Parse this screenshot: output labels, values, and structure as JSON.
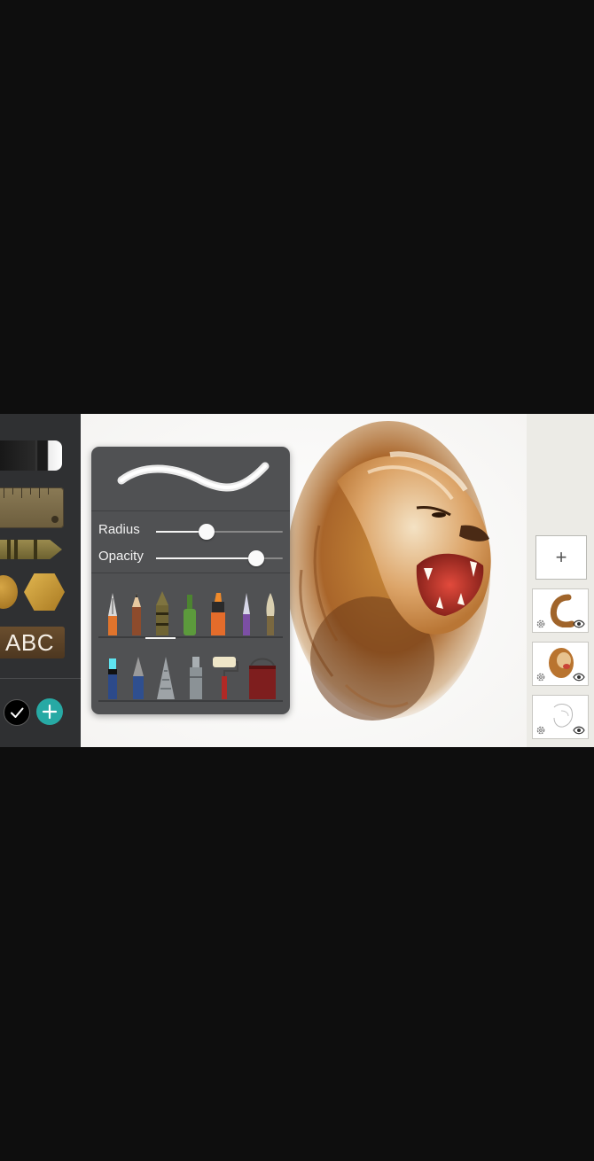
{
  "tools": {
    "items": [
      {
        "name": "paint tube"
      },
      {
        "name": "ruler"
      },
      {
        "name": "crayon"
      },
      {
        "name": "circle shape"
      },
      {
        "name": "hexagon shape"
      }
    ],
    "text_tool_label": "ABC"
  },
  "color": {
    "current": "#000000",
    "add_icon": "plus-icon",
    "accent": "#27A9A4"
  },
  "brush_panel": {
    "radius_label": "Radius",
    "radius_value": 0.4,
    "opacity_label": "Opacity",
    "opacity_value": 0.79,
    "row1": [
      "fountain pen",
      "pencil",
      "crayon",
      "paint bottle",
      "marker",
      "calligraphy pen",
      "brush"
    ],
    "row2": [
      "highlighter",
      "ink pen",
      "spray nozzle",
      "airbrush",
      "roller",
      "paint bucket"
    ],
    "selected_brush": "crayon"
  },
  "layers": {
    "add_icon": "plus-icon",
    "items": [
      {
        "thumb": "mane stroke layer"
      },
      {
        "thumb": "lion colour layer"
      },
      {
        "thumb": "lion sketch layer"
      }
    ]
  }
}
